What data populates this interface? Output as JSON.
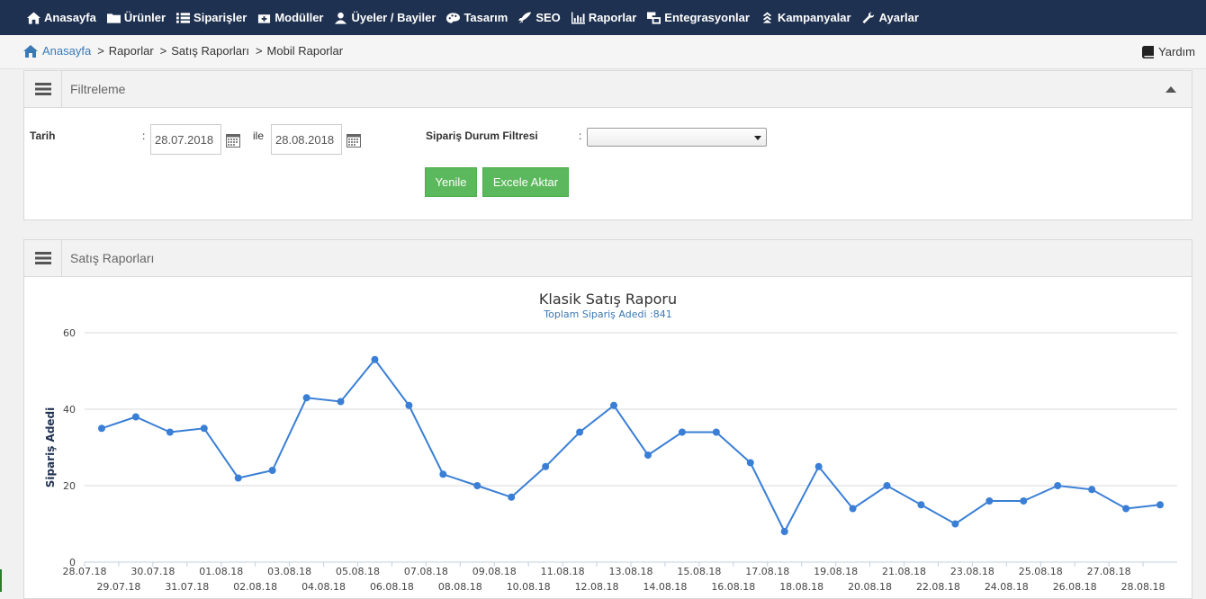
{
  "nav": {
    "items": [
      {
        "label": "Anasayfa",
        "icon": "home-icon"
      },
      {
        "label": "Ürünler",
        "icon": "folder-icon"
      },
      {
        "label": "Siparişler",
        "icon": "list-icon"
      },
      {
        "label": "Modüller",
        "icon": "module-box-icon"
      },
      {
        "label": "Üyeler / Bayiler",
        "icon": "user-icon"
      },
      {
        "label": "Tasarım",
        "icon": "palette-icon"
      },
      {
        "label": "SEO",
        "icon": "rocket-icon"
      },
      {
        "label": "Raporlar",
        "icon": "chart-icon"
      },
      {
        "label": "Entegrasyonlar",
        "icon": "integration-icon"
      },
      {
        "label": "Kampanyalar",
        "icon": "campaign-icon"
      },
      {
        "label": "Ayarlar",
        "icon": "wrench-icon"
      }
    ]
  },
  "breadcrumb": {
    "home": "Anasayfa",
    "items": [
      "Raporlar",
      "Satış Raporları",
      "Mobil Raporlar"
    ],
    "separator": ">"
  },
  "help": {
    "label": "Yardım"
  },
  "filter_panel": {
    "title": "Filtreleme",
    "date_label": "Tarih",
    "colon": ":",
    "date_from": "28.07.2018",
    "between": "ile",
    "date_to": "28.08.2018",
    "status_label": "Sipariş Durum Filtresi",
    "status_value": "",
    "refresh_button": "Yenile",
    "excel_button": "Excele Aktar"
  },
  "report_panel": {
    "title": "Satış Raporları"
  },
  "colors": {
    "nav_bg": "#1f3150",
    "line": "#3a7fd5",
    "button": "#5cb85c",
    "link": "#3a79b8"
  },
  "chart_data": {
    "type": "line",
    "title": "Klasik Satış Raporu",
    "subtitle": "Toplam Sipariş Adedi :841",
    "ylabel": "Sipariş Adedi",
    "xlabel": "",
    "ylim": [
      0,
      60
    ],
    "yticks": [
      0,
      20,
      40,
      60
    ],
    "grid": true,
    "x": [
      "28.07.18",
      "29.07.18",
      "30.07.18",
      "31.07.18",
      "01.08.18",
      "02.08.18",
      "03.08.18",
      "04.08.18",
      "05.08.18",
      "06.08.18",
      "07.08.18",
      "08.08.18",
      "09.08.18",
      "10.08.18",
      "11.08.18",
      "12.08.18",
      "13.08.18",
      "14.08.18",
      "15.08.18",
      "16.08.18",
      "17.08.18",
      "18.08.18",
      "19.08.18",
      "20.08.18",
      "21.08.18",
      "22.08.18",
      "23.08.18",
      "24.08.18",
      "25.08.18",
      "26.08.18",
      "27.08.18",
      "28.08.18"
    ],
    "values": [
      35,
      38,
      34,
      35,
      22,
      24,
      43,
      42,
      53,
      41,
      23,
      20,
      17,
      25,
      34,
      41,
      28,
      34,
      34,
      26,
      8,
      25,
      14,
      20,
      15,
      10,
      16,
      16,
      20,
      19,
      14,
      15
    ]
  }
}
